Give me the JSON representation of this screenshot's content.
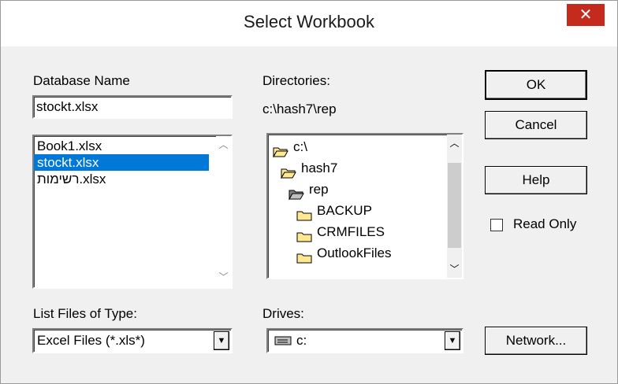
{
  "dialog": {
    "title": "Select Workbook",
    "close_glyph": "✕"
  },
  "database": {
    "label": "Database Name",
    "value": "stockt.xlsx",
    "files": [
      "Book1.xlsx",
      "stockt.xlsx",
      "רשימות.xlsx"
    ],
    "selected_index": 1
  },
  "directories": {
    "label": "Directories:",
    "current_path": "c:\\hash7\\rep",
    "items": [
      {
        "name": "c:\\",
        "icon": "open-folder-icon",
        "indent": 0
      },
      {
        "name": "hash7",
        "icon": "open-folder-icon",
        "indent": 1
      },
      {
        "name": "rep",
        "icon": "open-folder-dark-icon",
        "indent": 2
      },
      {
        "name": "BACKUP",
        "icon": "folder-icon",
        "indent": 3
      },
      {
        "name": "CRMFILES",
        "icon": "folder-icon",
        "indent": 3
      },
      {
        "name": "OutlookFiles",
        "icon": "folder-icon",
        "indent": 3
      }
    ]
  },
  "file_type": {
    "label": "List Files of Type:",
    "value": "Excel Files (*.xls*)"
  },
  "drives": {
    "label": "Drives:",
    "value": "c:",
    "icon": "drive-icon"
  },
  "buttons": {
    "ok": "OK",
    "cancel": "Cancel",
    "help": "Help",
    "network": "Network..."
  },
  "read_only": {
    "label": "Read Only",
    "checked": false
  },
  "colors": {
    "selection": "#0078d7",
    "close": "#c42b1c",
    "folder": "#ffe890"
  }
}
